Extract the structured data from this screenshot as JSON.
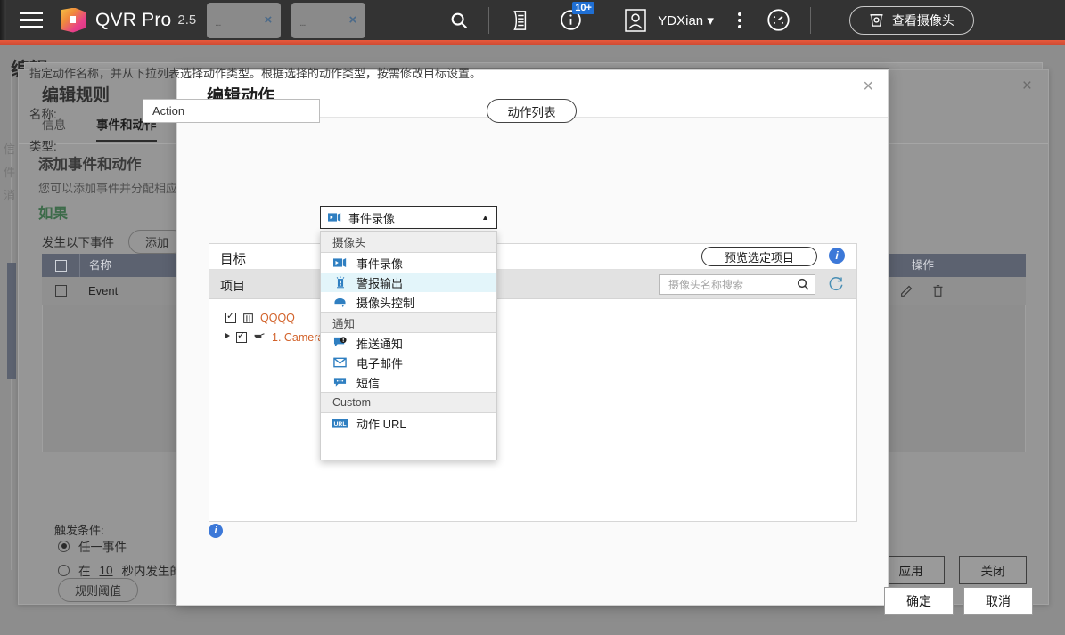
{
  "topbar": {
    "menu_icon": "hamburger-icon",
    "app_title": "QVR Pro",
    "app_version": "2.5",
    "tabs": [
      {
        "label": "...",
        "close": "×"
      },
      {
        "label": "...",
        "close": "×"
      }
    ],
    "search_icon": "search-icon",
    "log_icon": "log-icon",
    "notification_icon": "info-icon",
    "notification_badge": "10+",
    "avatar_icon": "user-avatar-icon",
    "user_name": "YDXian",
    "user_caret": "▾",
    "overflow_icon": "kebab-menu-icon",
    "dashboard_icon": "gauge-icon",
    "view_camera_label": "查看摄像头",
    "view_camera_icon": "camera-icon"
  },
  "background_dialog": {
    "page_title": "编辑",
    "title": "编辑规则",
    "close": "×",
    "tabs": [
      {
        "label": "信息",
        "active": false
      },
      {
        "label": "事件和动作",
        "active": true
      }
    ],
    "section_title": "添加事件和动作",
    "section_desc": "您可以添加事件并分配相应的",
    "if_label": "如果",
    "event_toolbar_label": "发生以下事件",
    "add_button": "添加",
    "table_headers": {
      "name": "名称",
      "operation": "操作"
    },
    "rows": [
      {
        "name": "Event",
        "edit_icon": "edit-icon",
        "delete_icon": "trash-icon"
      }
    ],
    "trigger_label": "触发条件:",
    "radio_any": "任一事件",
    "radio_all_prefix": "在",
    "radio_all_seconds": "10",
    "radio_all_suffix": "秒内发生的所有事",
    "threshold_button": "规则阈值",
    "apply_button": "应用",
    "close_button": "关闭",
    "side_words": "信件消"
  },
  "modal": {
    "title": "编辑动作",
    "close": "×",
    "description": "指定动作名称，并从下拉列表选择动作类型。根据选择的动作类型，按需修改目标设置。",
    "name_label": "名称:",
    "name_value": "Action",
    "name_placeholder": "",
    "action_list_button": "动作列表",
    "type_label": "类型:",
    "type_selected": "事件录像",
    "type_selected_icon": "video-record-icon",
    "type_caret": "▲",
    "dropdown": {
      "groups": [
        {
          "label": "摄像头",
          "options": [
            {
              "label": "事件录像",
              "icon": "video-record-icon",
              "highlighted": false
            },
            {
              "label": "警报输出",
              "icon": "alarm-output-icon",
              "highlighted": true
            },
            {
              "label": "摄像头控制",
              "icon": "camera-control-icon",
              "highlighted": false
            }
          ]
        },
        {
          "label": "通知",
          "options": [
            {
              "label": "推送通知",
              "icon": "push-notification-icon",
              "highlighted": false
            },
            {
              "label": "电子邮件",
              "icon": "email-icon",
              "highlighted": false
            },
            {
              "label": "短信",
              "icon": "sms-icon",
              "highlighted": false
            }
          ]
        },
        {
          "label": "Custom",
          "options": [
            {
              "label": "动作 URL",
              "icon": "url-icon",
              "highlighted": false
            }
          ]
        }
      ]
    },
    "target": {
      "header": "目标",
      "preview_button": "预览选定项目",
      "info_icon": "info-circle-icon",
      "subheader": "项目",
      "search_placeholder": "摄像头名称搜索",
      "search_value": "",
      "search_icon": "search-icon",
      "refresh_icon": "refresh-icon",
      "tree": [
        {
          "label": "QQQQ",
          "icon": "server-icon",
          "checked": true,
          "level": 0
        },
        {
          "label": "1. Camera",
          "icon": "camera-icon",
          "checked": true,
          "level": 1
        }
      ]
    },
    "info_icon": "info-circle-icon",
    "ok_button": "确定",
    "cancel_button": "取消"
  },
  "colors": {
    "topbar_bg": "#333333",
    "accent": "#e8593c",
    "highlight": "#e3f5fa",
    "icon_blue": "#2f7fc1",
    "info_blue": "#3c78d8",
    "tree_text": "#d2622a",
    "if_green": "#3d6b4a"
  }
}
